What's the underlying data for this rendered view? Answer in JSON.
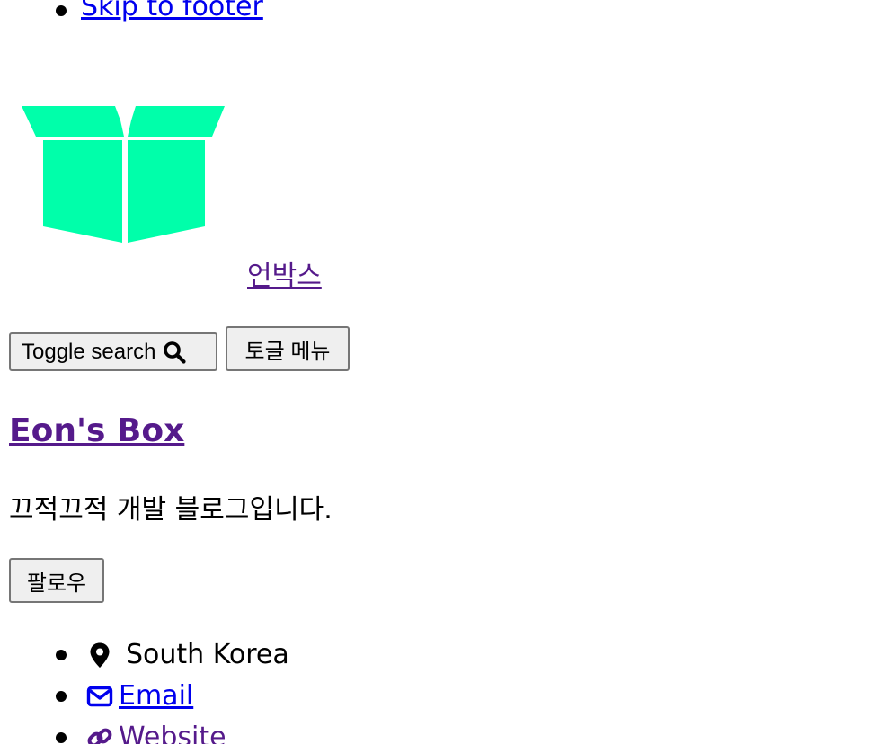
{
  "skip_links": [
    {
      "label": "Skip to footer"
    }
  ],
  "site": {
    "logo_icon": "open-box-icon",
    "logo_color": "#00ffaa",
    "name": "언박스"
  },
  "controls": {
    "toggle_search_label": "Toggle search",
    "toggle_menu_label": "토글 메뉴"
  },
  "author": {
    "title": "Eon's Box",
    "tagline": "끄적끄적 개발 블로그입니다.",
    "follow_label": "팔로우",
    "links": [
      {
        "icon": "map-marker-icon",
        "label": "South Korea",
        "type": "text"
      },
      {
        "icon": "envelope-icon",
        "label": "Email",
        "type": "link"
      },
      {
        "icon": "link-icon",
        "label": "Website",
        "type": "link"
      }
    ]
  },
  "colors": {
    "link": "#0000ee",
    "visited_link": "#551a8b"
  }
}
